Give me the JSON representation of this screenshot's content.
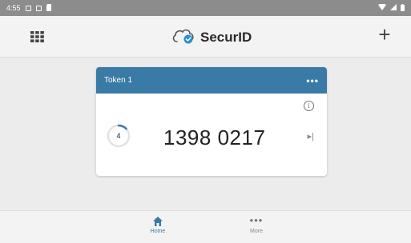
{
  "status_bar": {
    "time": "4:55"
  },
  "header": {
    "app_name": "SecurID"
  },
  "token": {
    "name": "Token 1",
    "menu_label": "•••",
    "timer_seconds": "4",
    "timer_remaining_fraction": 0.13,
    "code": "1398 0217",
    "info_glyph": "i",
    "next_glyph": "▸|"
  },
  "nav": {
    "home_label": "Home",
    "more_label": "More",
    "more_glyph": "•••"
  },
  "colors": {
    "status_bar_bg": "#8c8c8c",
    "accent_blue": "#3a7aa6",
    "logo_check": "#2c8fd6",
    "background": "#ececec"
  },
  "icons": {
    "grid": "grid-icon",
    "add": "plus-icon",
    "info": "info-icon",
    "next_code": "next-code-icon",
    "home": "home-icon",
    "more": "more-icon"
  }
}
